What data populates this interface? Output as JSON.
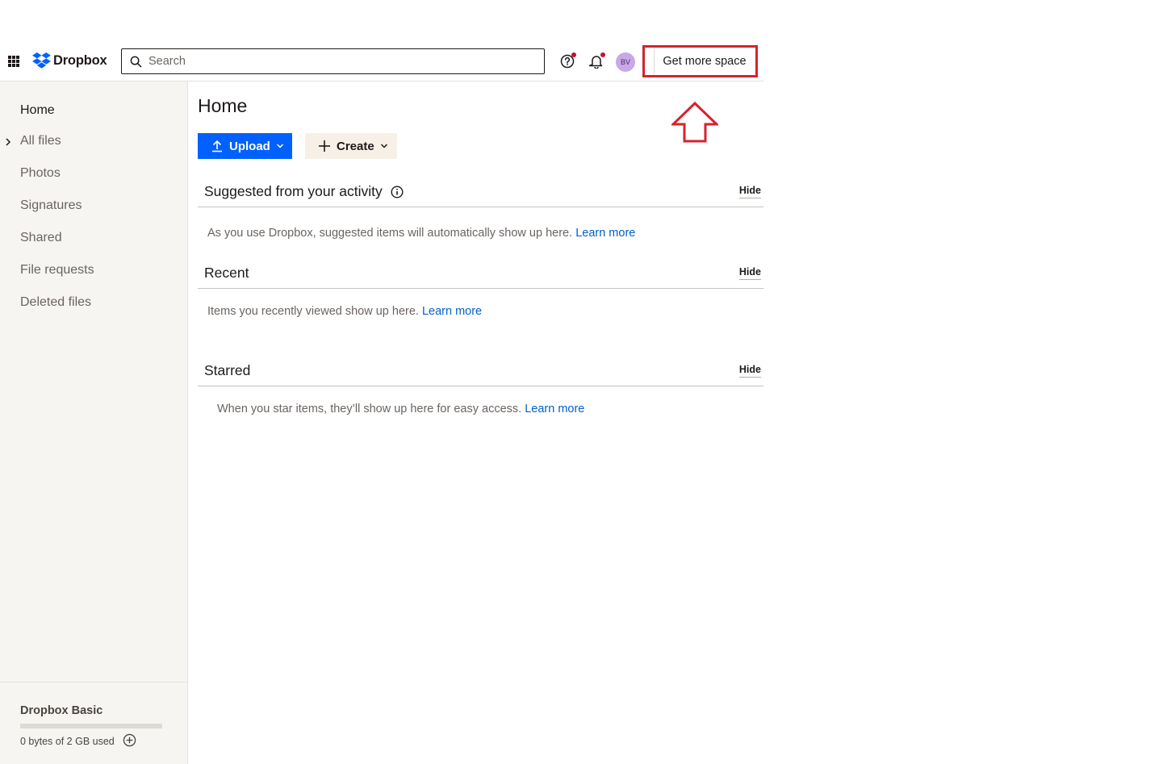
{
  "header": {
    "app_name": "Dropbox",
    "search_placeholder": "Search",
    "avatar_initials": "BV",
    "get_more_space_label": "Get more space"
  },
  "sidebar": {
    "items": [
      {
        "label": "Home"
      },
      {
        "label": "All files"
      },
      {
        "label": "Photos"
      },
      {
        "label": "Signatures"
      },
      {
        "label": "Shared"
      },
      {
        "label": "File requests"
      },
      {
        "label": "Deleted files"
      }
    ],
    "plan": {
      "name": "Dropbox Basic",
      "usage_text": "0 bytes of 2 GB used",
      "usage_fraction": 0.0
    }
  },
  "main": {
    "title": "Home",
    "upload_label": "Upload",
    "create_label": "Create",
    "sections": [
      {
        "title": "Suggested from your activity",
        "hide_label": "Hide",
        "body": "As you use Dropbox, suggested items will automatically show up here.",
        "link": "Learn more"
      },
      {
        "title": "Recent",
        "hide_label": "Hide",
        "body": "Items you recently viewed show up here.",
        "link": "Learn more"
      },
      {
        "title": "Starred",
        "hide_label": "Hide",
        "body": "When you star items, they’ll show up here for easy access.",
        "link": "Learn more"
      }
    ]
  },
  "colors": {
    "accent": "#0061fe",
    "annotation": "#d6222d",
    "notification_dot": "#c8102e"
  }
}
